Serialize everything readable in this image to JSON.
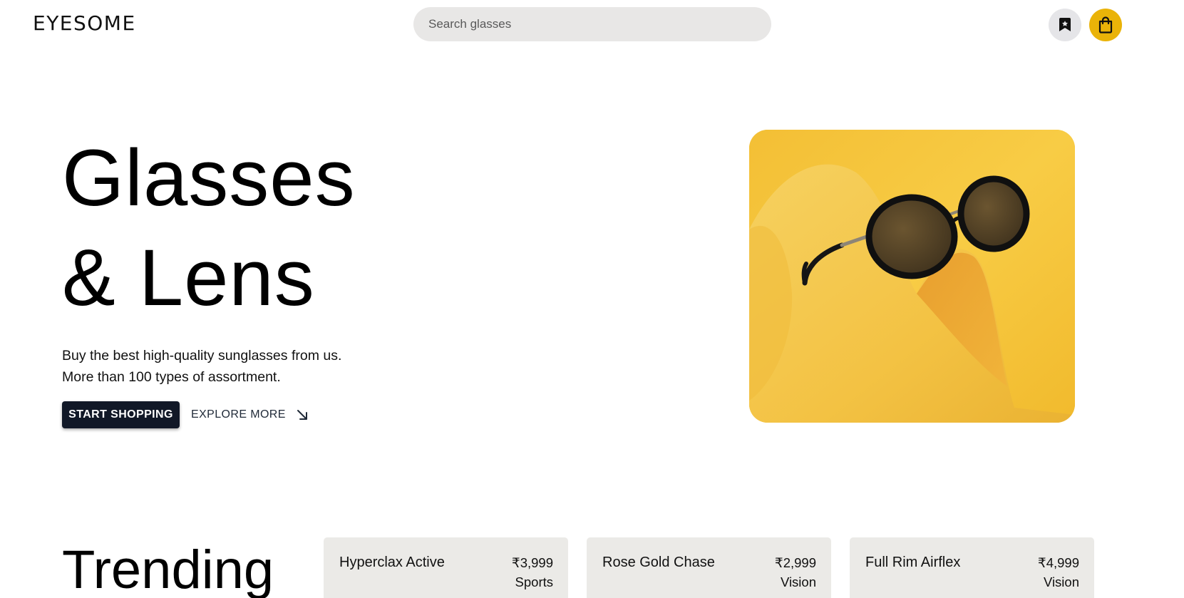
{
  "header": {
    "logo": "EYESOME",
    "search_placeholder": "Search glasses",
    "bookmark_icon": "bookmark-icon",
    "bag_icon": "shopping-bag-icon",
    "bag_color": "#eab308"
  },
  "hero": {
    "title_line1": "Glasses",
    "title_line2": "& Lens",
    "desc_line1": "Buy the best high-quality sunglasses from us.",
    "desc_line2": "More than 100 types of assortment.",
    "primary_button": "START SHOPPING",
    "secondary_button": "EXPLORE MORE",
    "secondary_icon": "arrow-down-right-icon",
    "image_icon": "sunglasses-on-yellow-paper-image",
    "accent_color": "#f4c23a",
    "primary_button_color": "#111827"
  },
  "trending": {
    "title": "Trending",
    "products": [
      {
        "name": "Hyperclax Active",
        "price": "₹3,999",
        "category": "Sports"
      },
      {
        "name": "Rose Gold Chase",
        "price": "₹2,999",
        "category": "Vision"
      },
      {
        "name": "Full Rim Airflex",
        "price": "₹4,999",
        "category": "Vision"
      }
    ]
  }
}
